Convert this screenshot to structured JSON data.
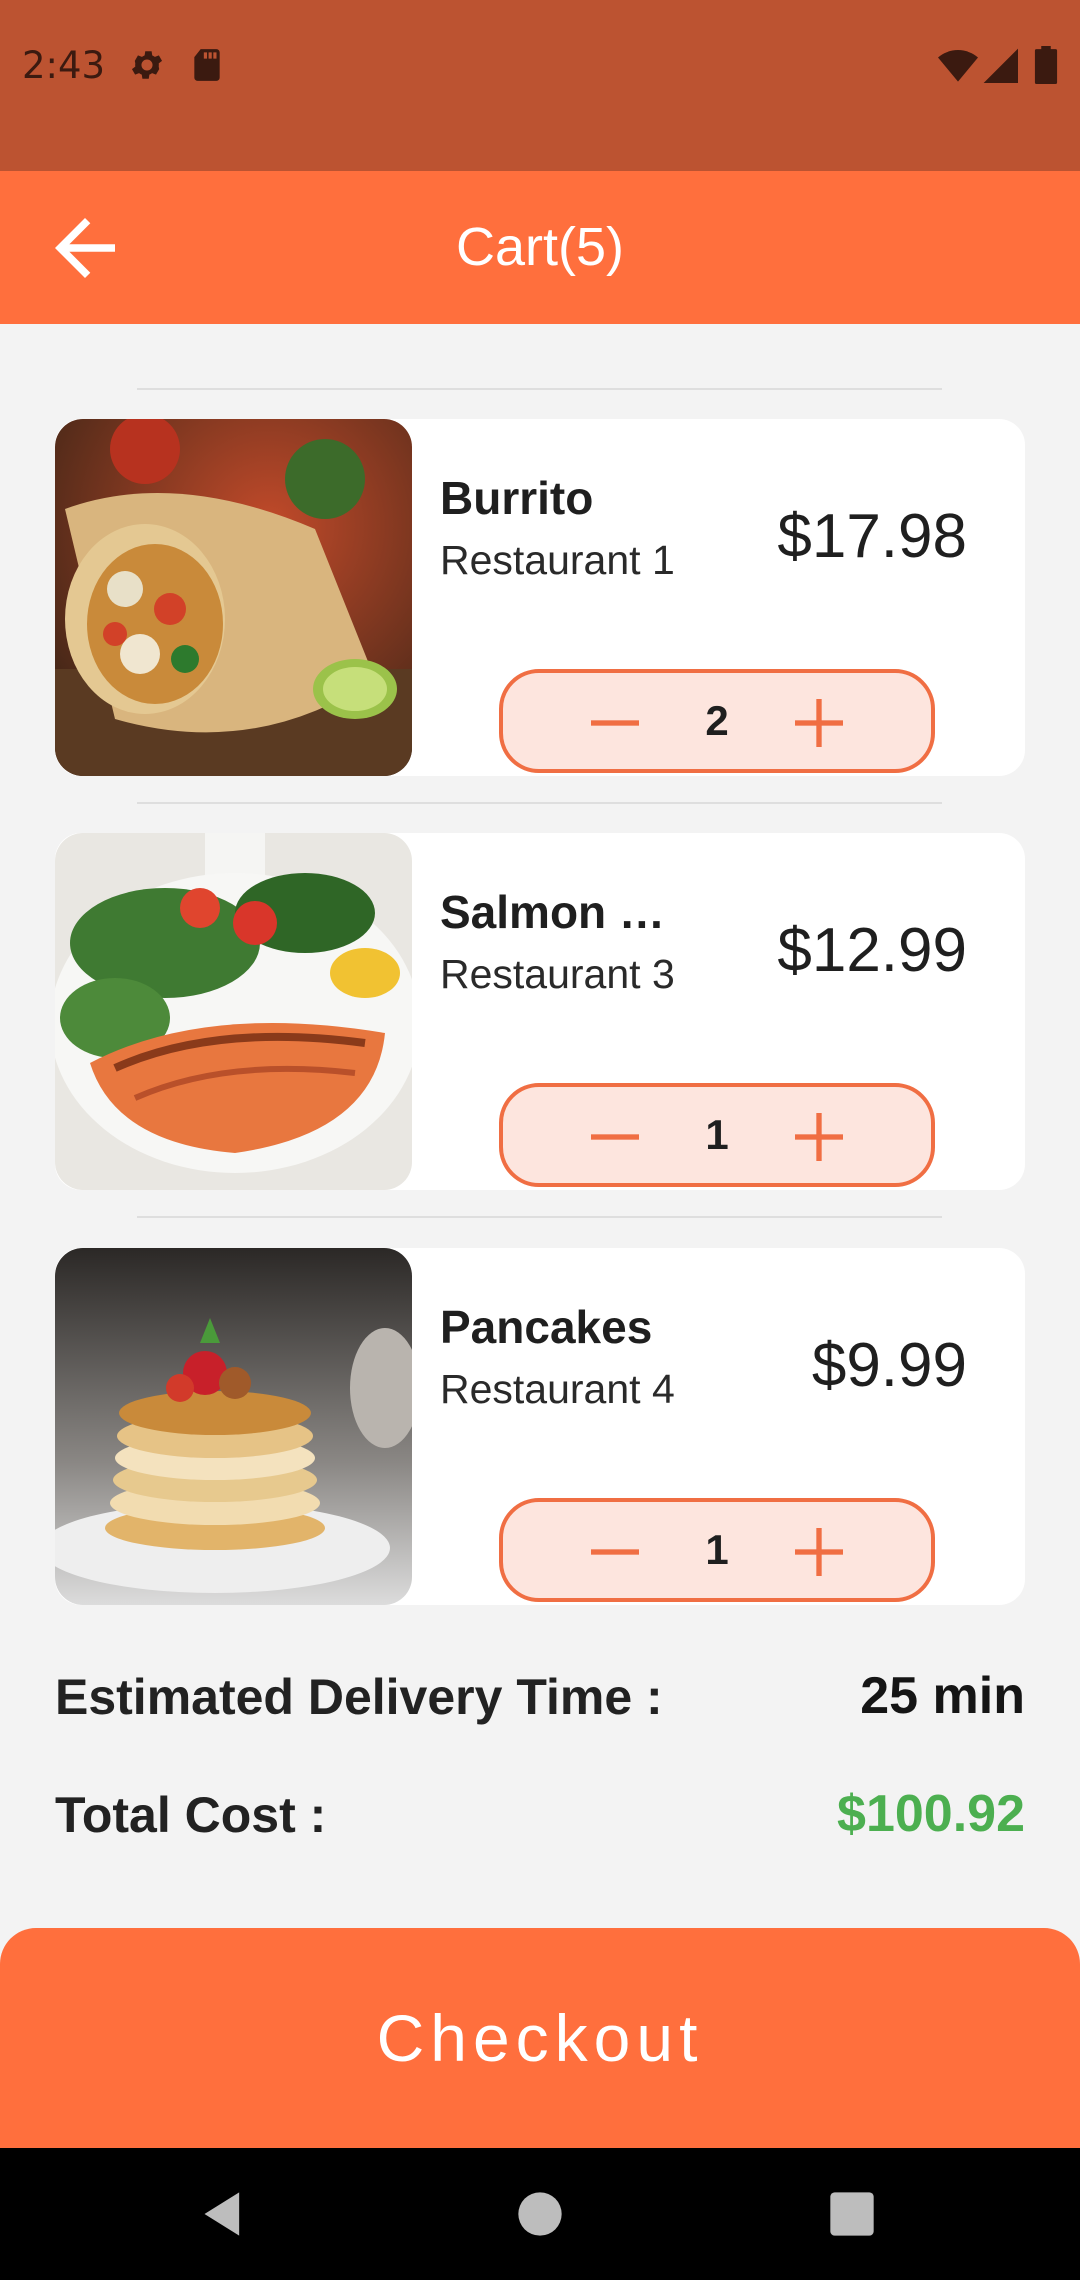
{
  "status_bar": {
    "time": "2:43"
  },
  "app_bar": {
    "title": "Cart(5)"
  },
  "cart": {
    "items": [
      {
        "name": "Burrito",
        "restaurant": "Restaurant 1",
        "price": "$17.98",
        "quantity": "2"
      },
      {
        "name": "Salmon …",
        "restaurant": "Restaurant 3",
        "price": "$12.99",
        "quantity": "1"
      },
      {
        "name": "Pancakes",
        "restaurant": "Restaurant 4",
        "price": "$9.99",
        "quantity": "1"
      }
    ]
  },
  "summary": {
    "delivery_label": "Estimated Delivery Time :",
    "delivery_value": "25 min",
    "total_label": "Total Cost :",
    "total_value": "$100.92"
  },
  "checkout": {
    "label": "Checkout"
  },
  "colors": {
    "status_bar": "#bc5331",
    "accent": "#ff6f3d",
    "stepper_bg": "#fde5de",
    "total": "#4caf50"
  },
  "icons": {
    "back": "arrow-back-icon",
    "minus": "minus-icon",
    "plus": "plus-icon"
  }
}
